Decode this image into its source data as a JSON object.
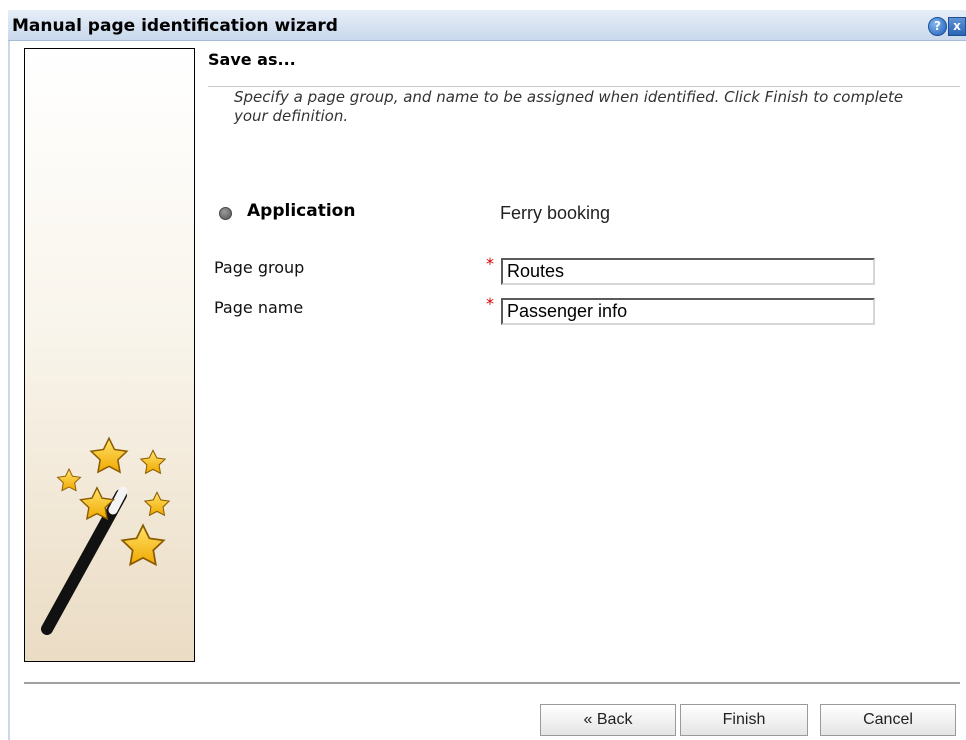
{
  "window": {
    "title": "Manual page identification wizard",
    "help_glyph": "?",
    "close_glyph": "x",
    "help_icon": "help-icon",
    "close_icon": "close-icon"
  },
  "side_image": {
    "icon": "magic-wand-stars-icon"
  },
  "step": {
    "title": "Save as...",
    "instructions": "Specify a page group, and name to be assigned when identified. Click Finish to complete your definition."
  },
  "form": {
    "application_label": "Application",
    "application_value": "Ferry booking",
    "page_group_label": "Page group",
    "page_group_value": "Routes",
    "page_name_label": "Page name",
    "page_name_value": "Passenger info",
    "required_marker": "*"
  },
  "buttons": {
    "back": "« Back",
    "finish": "Finish",
    "cancel": "Cancel"
  },
  "colors": {
    "title_bar": "#c9d8ec",
    "required": "#d40000",
    "star": "#f7c417"
  }
}
